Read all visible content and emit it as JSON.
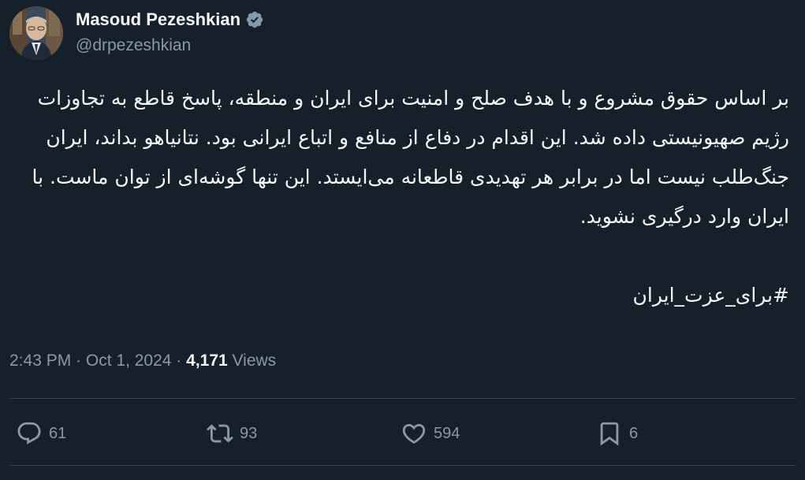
{
  "author": {
    "display_name": "Masoud Pezeshkian",
    "handle": "@drpezeshkian",
    "verified_icon": "verified-badge-icon"
  },
  "tweet": {
    "text": "بر اساس حقوق مشروع و با هدف صلح و امنیت برای ایران و منطقه، پاسخ قاطع به تجاوزات رژیم صهیونیستی داده شد. این اقدام در دفاع از منافع و اتباع ایرانی بود. نتانیاهو بداند، ایران جنگ‌طلب نیست اما در برابر هر تهدیدی قاطعانه می‌ایستد. این تنها گوشه‌ای از توان ماست. با ایران وارد درگیری نشوید.",
    "hashtag": "#برای_عزت_ایران"
  },
  "meta": {
    "time": "2:43 PM",
    "separator": " · ",
    "date": "Oct 1, 2024",
    "views_count": "4,171",
    "views_label": " Views"
  },
  "actions": {
    "reply": {
      "icon": "reply-icon",
      "count": "61"
    },
    "repost": {
      "icon": "repost-icon",
      "count": "93"
    },
    "like": {
      "icon": "heart-icon",
      "count": "594"
    },
    "bookmark": {
      "icon": "bookmark-icon",
      "count": "6"
    }
  },
  "colors": {
    "background": "#15202b",
    "text": "#f7f9f9",
    "secondary_text": "#8b98a5",
    "divider": "#38444d",
    "verified_badge": "#829aab"
  }
}
